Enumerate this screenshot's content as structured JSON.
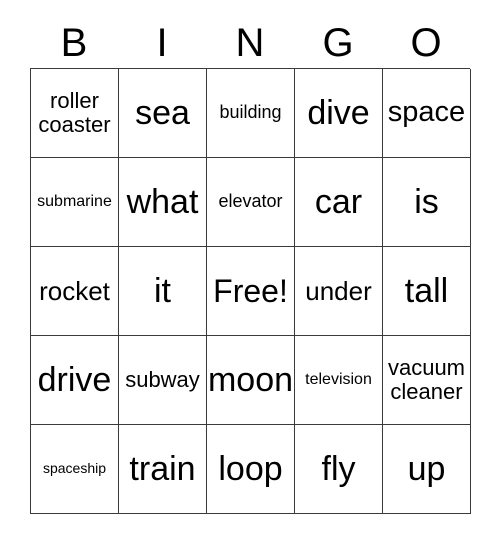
{
  "card": {
    "header": {
      "letters": [
        "B",
        "I",
        "N",
        "G",
        "O"
      ]
    },
    "rows": [
      [
        {
          "text": "roller\ncoaster",
          "size": "fs-lg",
          "free": false
        },
        {
          "text": "sea",
          "size": "fs-4xl",
          "free": false
        },
        {
          "text": "building",
          "size": "fs-md",
          "free": false
        },
        {
          "text": "dive",
          "size": "fs-4xl",
          "free": false
        },
        {
          "text": "space",
          "size": "fs-2xl",
          "free": false
        }
      ],
      [
        {
          "text": "submarine",
          "size": "fs-sm",
          "free": false
        },
        {
          "text": "what",
          "size": "fs-4xl",
          "free": false
        },
        {
          "text": "elevator",
          "size": "fs-md",
          "free": false
        },
        {
          "text": "car",
          "size": "fs-4xl",
          "free": false
        },
        {
          "text": "is",
          "size": "fs-4xl",
          "free": false
        }
      ],
      [
        {
          "text": "rocket",
          "size": "fs-xl",
          "free": false
        },
        {
          "text": "it",
          "size": "fs-4xl",
          "free": false
        },
        {
          "text": "Free!",
          "size": "fs-3xl",
          "free": true
        },
        {
          "text": "under",
          "size": "fs-xl",
          "free": false
        },
        {
          "text": "tall",
          "size": "fs-4xl",
          "free": false
        }
      ],
      [
        {
          "text": "drive",
          "size": "fs-4xl",
          "free": false
        },
        {
          "text": "subway",
          "size": "fs-lg",
          "free": false
        },
        {
          "text": "moon",
          "size": "fs-4xl",
          "free": false
        },
        {
          "text": "television",
          "size": "fs-sm",
          "free": false
        },
        {
          "text": "vacuum\ncleaner",
          "size": "fs-lg",
          "free": false
        }
      ],
      [
        {
          "text": "spaceship",
          "size": "fs-xs",
          "free": false
        },
        {
          "text": "train",
          "size": "fs-4xl",
          "free": false
        },
        {
          "text": "loop",
          "size": "fs-4xl",
          "free": false
        },
        {
          "text": "fly",
          "size": "fs-4xl",
          "free": false
        },
        {
          "text": "up",
          "size": "fs-4xl",
          "free": false
        }
      ]
    ]
  },
  "colors": {
    "background": "#ffffff",
    "text": "#000000",
    "border": "#3a3a3a"
  }
}
